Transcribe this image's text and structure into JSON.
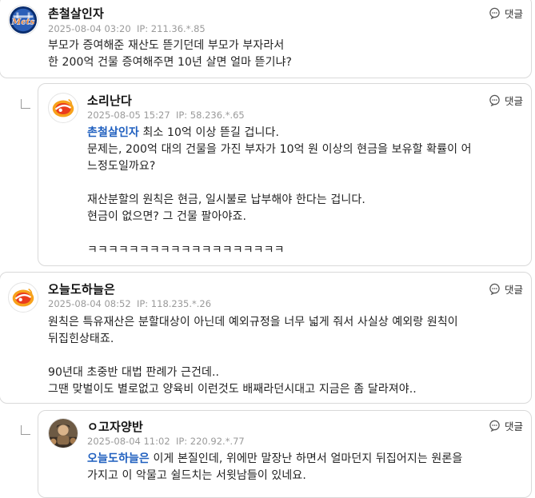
{
  "comments": [
    {
      "author": "촌철살인자",
      "avatar_icon": "mets-logo-icon",
      "date": "2025-08-04 03:20",
      "ip": "IP: 211.36.*.85",
      "reply_label": "댓글",
      "lines": [
        "부모가 증여해준 재산도 뜯기던데 부모가 부자라서",
        "한 200억 건물 증여해주면 10년 살면 얼마 뜯기냐?"
      ]
    },
    {
      "author": "소리난다",
      "avatar_icon": "orange-swirl-logo-icon",
      "date": "2025-08-05 15:27",
      "ip": "IP: 58.236.*.65",
      "reply_label": "댓글",
      "mention": "촌철살인자",
      "first_line_rest": " 최소 10억 이상 뜯길 겁니다.",
      "lines": [
        "문제는, 200억 대의 건물을 가진 부자가 10억 원 이상의 현금을 보유할 확률이 어",
        "느정도일까요?",
        "",
        "재산분할의 원칙은 현금, 일시불로 납부해야 한다는 겁니다.",
        "현금이 없으면? 그 건물 팔아야죠.",
        "",
        "ㅋㅋㅋㅋㅋㅋㅋㅋㅋㅋㅋㅋㅋㅋㅋㅋㅋㅋㅋ"
      ]
    },
    {
      "author": "오늘도하늘은",
      "avatar_icon": "orange-swirl-logo-icon",
      "date": "2025-08-04 08:52",
      "ip": "IP: 118.235.*.26",
      "reply_label": "댓글",
      "lines": [
        "원칙은 특유재산은 분할대상이 아닌데 예외규정을 너무 넓게 줘서 사실상 예외랑 원칙이",
        "뒤집힌상태죠.",
        "",
        "90년대 초중반 대법 판례가 근건데..",
        "그땐 맞벌이도 별로없고 양육비 이런것도 배째라던시대고 지금은 좀 달라져야.."
      ]
    },
    {
      "author": "ㅇ고자양반",
      "avatar_icon": "photo-avatar-icon",
      "date": "2025-08-04 11:02",
      "ip": "IP: 220.92.*.77",
      "reply_label": "댓글",
      "mention": "오늘도하늘은",
      "first_line_rest": " 이게 본질인데, 위에만 말장난 하면서 얼마던지 뒤집어지는 원론을",
      "lines": [
        "가지고 이 악물고 쉴드치는 서윗남들이 있네요."
      ]
    }
  ],
  "colors": {
    "mention": "#1f5fbf",
    "meta": "#9a9a9a",
    "border": "#d9d9d9",
    "mets_blue": "#0a2d6e",
    "mets_orange": "#f47a20"
  }
}
